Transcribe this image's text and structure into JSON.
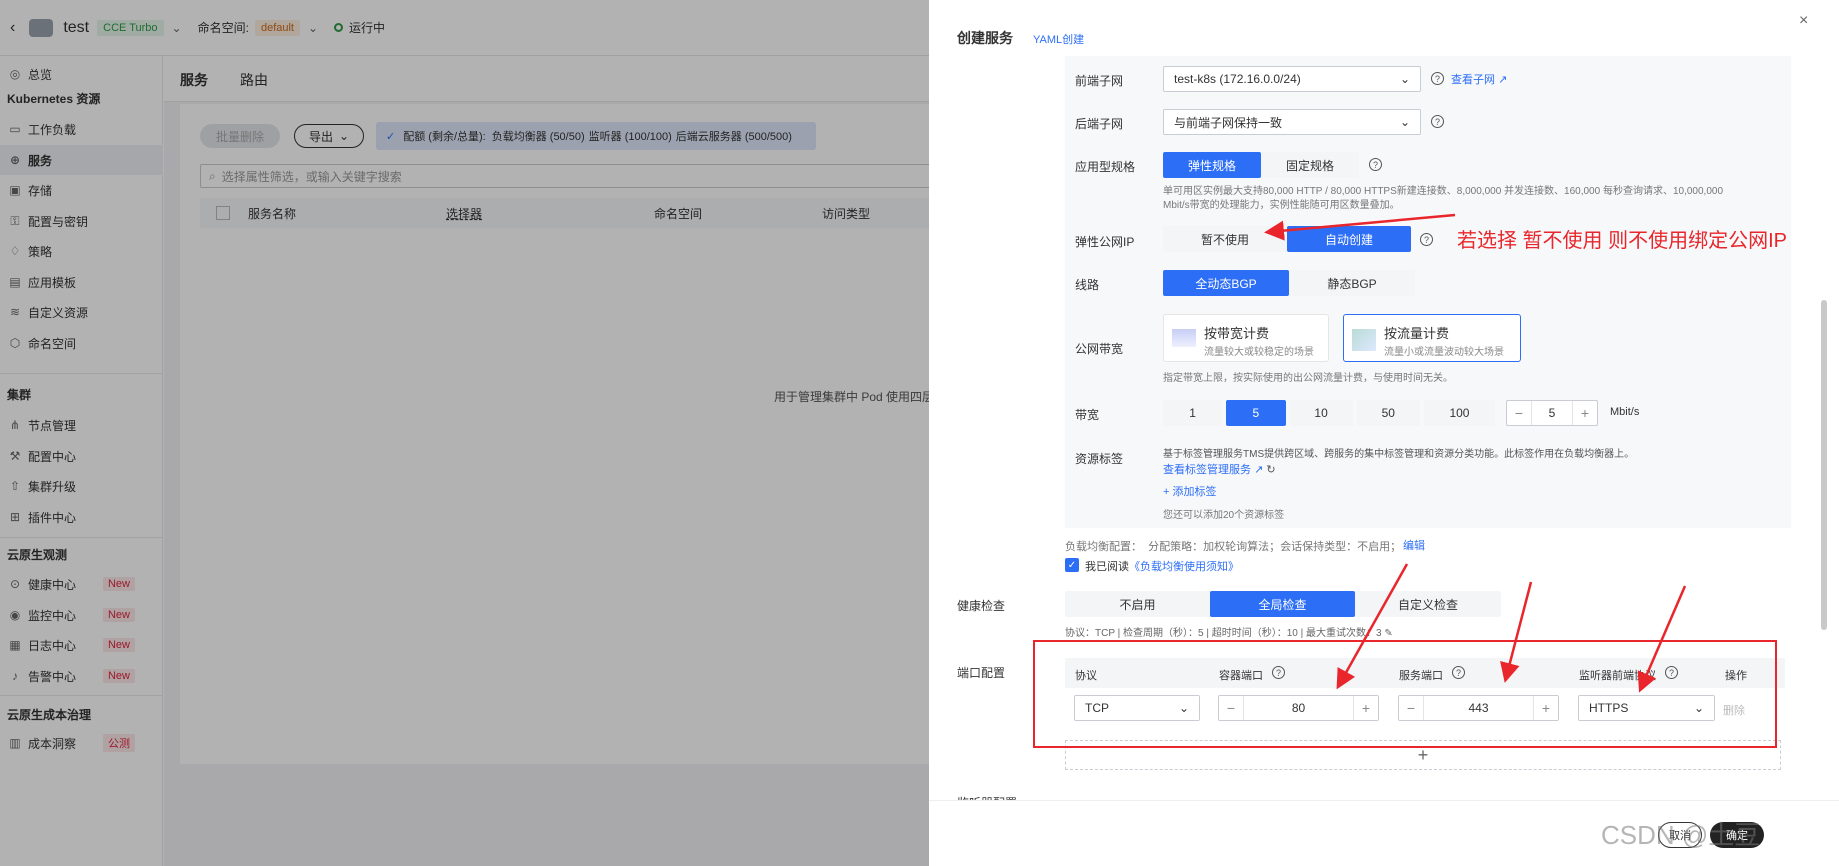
{
  "topbar": {
    "cluster_name": "test",
    "cluster_type": "CCE Turbo",
    "namespace_label": "命名空间:",
    "namespace_value": "default",
    "status": "运行中"
  },
  "sidebar": {
    "items": [
      {
        "label": "总览",
        "icon": "dashboard-icon"
      },
      {
        "group": "Kubernetes 资源"
      },
      {
        "label": "工作负载",
        "icon": "workload-icon"
      },
      {
        "label": "服务",
        "icon": "globe-icon",
        "active": true
      },
      {
        "label": "存储",
        "icon": "storage-icon"
      },
      {
        "label": "配置与密钥",
        "icon": "config-icon"
      },
      {
        "label": "策略",
        "icon": "policy-icon"
      },
      {
        "label": "应用模板",
        "icon": "template-icon"
      },
      {
        "label": "自定义资源",
        "icon": "layers-icon"
      },
      {
        "label": "命名空间",
        "icon": "cube-icon"
      },
      {
        "group": "集群"
      },
      {
        "label": "节点管理",
        "icon": "node-icon"
      },
      {
        "label": "配置中心",
        "icon": "wrench-icon"
      },
      {
        "label": "集群升级",
        "icon": "upgrade-icon"
      },
      {
        "label": "插件中心",
        "icon": "grid-icon"
      },
      {
        "group": "云原生观测"
      },
      {
        "label": "健康中心",
        "icon": "health-icon",
        "badge": "New"
      },
      {
        "label": "监控中心",
        "icon": "monitor-icon",
        "badge": "New"
      },
      {
        "label": "日志中心",
        "icon": "log-icon",
        "badge": "New"
      },
      {
        "label": "告警中心",
        "icon": "alarm-icon",
        "badge": "New"
      },
      {
        "group": "云原生成本治理"
      },
      {
        "label": "成本洞察",
        "icon": "cost-icon",
        "badge": "公测"
      }
    ]
  },
  "main": {
    "tabs": [
      "服务",
      "路由"
    ],
    "batch_delete": "批量删除",
    "export": "导出",
    "quota_prefix": "配额 (剩余/总量):",
    "quota_lb": "负载均衡器 (50/50)",
    "quota_listener": "监听器 (100/100)",
    "quota_backend": "后端云服务器 (500/500)",
    "filter_placeholder": "选择属性筛选，或输入关键字搜索",
    "columns": [
      "服务名称",
      "选择器",
      "命名空间",
      "访问类型"
    ],
    "empty_text": "用于管理集群中 Pod 使用四层网络"
  },
  "drawer": {
    "title": "创建服务",
    "yaml_link": "YAML创建",
    "frontend_subnet_label": "前端子网",
    "frontend_subnet_value": "test-k8s (172.16.0.0/24)",
    "view_subnet": "查看子网",
    "backend_subnet_label": "后端子网",
    "backend_subnet_value": "与前端子网保持一致",
    "spec_label": "应用型规格",
    "spec_options": [
      "弹性规格",
      "固定规格"
    ],
    "spec_desc_1": "单可用区实例最大支持80,000 HTTP / 80,000 HTTPS新建连接数、8,000,000 并发连接数、160,000 每秒查询请求、10,000,000",
    "spec_desc_2": "Mbit/s带宽的处理能力，实例性能随可用区数量叠加。",
    "eip_label": "弹性公网IP",
    "eip_options": [
      "暂不使用",
      "自动创建"
    ],
    "annotation": "若选择 暂不使用 则不使用绑定公网IP",
    "line_label": "线路",
    "line_options": [
      "全动态BGP",
      "静态BGP"
    ],
    "bandwidth_type_label": "公网带宽",
    "bw_card1_title": "按带宽计费",
    "bw_card1_desc": "流量较大或较稳定的场景",
    "bw_card2_title": "按流量计费",
    "bw_card2_desc": "流量小或流量波动较大场景",
    "bw_note": "指定带宽上限，按实际使用的出公网流量计费，与使用时间无关。",
    "bandwidth_label": "带宽",
    "bandwidth_options": [
      "1",
      "5",
      "10",
      "50",
      "100"
    ],
    "bandwidth_value": "5",
    "bandwidth_unit": "Mbit/s",
    "tags_label": "资源标签",
    "tags_desc": "基于标签管理服务TMS提供跨区域、跨服务的集中标签管理和资源分类功能。此标签作用在负载均衡器上。",
    "tags_link": "查看标签管理服务",
    "add_tag": "添加标签",
    "tags_remaining": "您还可以添加20个资源标签",
    "lb_config": "负载均衡配置：  分配策略：加权轮询算法；会话保持类型：不启用；",
    "edit": "编辑",
    "agree_prefix": "我已阅读",
    "agree_link": "《负载均衡使用须知》",
    "health_label": "健康检查",
    "health_options": [
      "不启用",
      "全局检查",
      "自定义检查"
    ],
    "health_desc": "协议：TCP | 检查周期（秒）：5 | 超时时间（秒）：10 | 最大重试次数：3",
    "port_label": "端口配置",
    "port_columns": [
      "协议",
      "容器端口",
      "服务端口",
      "监听器前端协议",
      "操作"
    ],
    "port_protocol": "TCP",
    "container_port": "80",
    "service_port": "443",
    "listener_protocol": "HTTPS",
    "delete": "删除",
    "listener_label": "监听器配置",
    "cancel": "取消",
    "confirm": "确定",
    "watermark": "CSDN @土豆"
  },
  "colors": {
    "primary": "#2d6ef7",
    "annotation_red": "#e8262b"
  }
}
